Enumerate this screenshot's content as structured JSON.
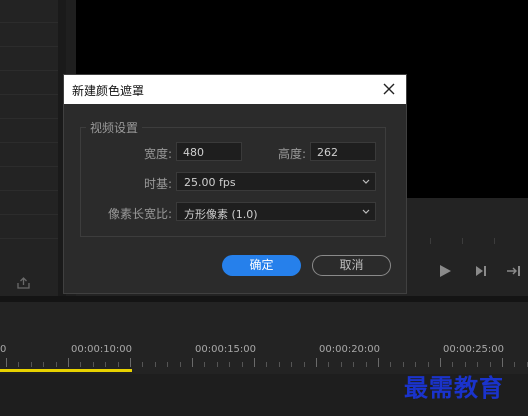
{
  "timeline": {
    "timecodes": [
      "0",
      "00:00:10:00",
      "00:00:15:00",
      "00:00:20:00",
      "00:00:25:00"
    ]
  },
  "watermark": {
    "text": "最需教育"
  },
  "dialog": {
    "title": "新建颜色遮罩",
    "group_label": "视频设置",
    "width_label": "宽度:",
    "width_value": "480",
    "height_label": "高度:",
    "height_value": "262",
    "timebase_label": "时基:",
    "timebase_value": "25.00 fps",
    "aspect_label": "像素长宽比:",
    "aspect_value": "方形像素 (1.0)",
    "ok_label": "确定",
    "cancel_label": "取消"
  },
  "colors": {
    "accent": "#2680eb",
    "playhead_bar": "#e8d200",
    "watermark": "#1a33cc"
  },
  "icons": [
    "close-icon",
    "chevron-down-icon",
    "play-icon",
    "step-forward-icon",
    "insert-icon",
    "export-icon"
  ]
}
